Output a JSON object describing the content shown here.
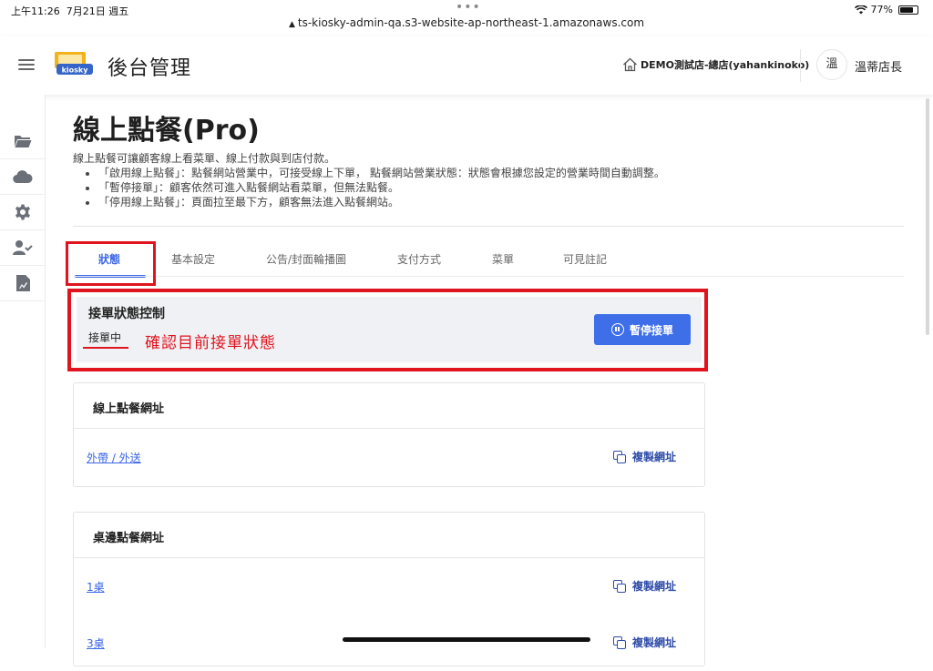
{
  "statusbar": {
    "time": "上午11:26",
    "date": "7月21日 週五",
    "battery": "77%",
    "battery_level": 0.77
  },
  "browser": {
    "url": "ts-kiosky-admin-qa.s3-website-ap-northeast-1.amazonaws.com"
  },
  "header": {
    "logo_text": "kiosky",
    "title": "後台管理",
    "store": "DEMO測試店-總店(yahankinoko)",
    "avatar": "溫",
    "user": "溫蒂店長"
  },
  "sidebar": {
    "items": [
      "folder-icon",
      "cloud-icon",
      "gear-icon",
      "user-check-icon",
      "report-icon"
    ]
  },
  "page": {
    "title": "線上點餐(Pro)",
    "intro": "線上點餐可讓顧客線上看菜單、線上付款與到店付款。",
    "bullets": [
      "「啟用線上點餐」：點餐網站營業中，可接受線上下單， 點餐網站營業狀態：狀態會根據您設定的營業時間自動調整。",
      "「暫停接單」：顧客依然可進入點餐網站看菜單，但無法點餐。",
      "「停用線上點餐」：頁面拉至最下方，顧客無法進入點餐網站。"
    ]
  },
  "tabs": [
    {
      "label": "狀態",
      "active": true
    },
    {
      "label": "基本設定"
    },
    {
      "label": "公告/封面輪播圖"
    },
    {
      "label": "支付方式"
    },
    {
      "label": "菜單"
    },
    {
      "label": "可見註記"
    }
  ],
  "status_card": {
    "title": "接單狀態控制",
    "value": "接單中",
    "annotation": "確認目前接單狀態",
    "pause_button": "暫停接單"
  },
  "online_urls": {
    "title": "線上點餐網址",
    "rows": [
      {
        "label": "外帶 / 外送",
        "copy": "複製網址"
      }
    ]
  },
  "table_urls": {
    "title": "桌邊點餐網址",
    "rows": [
      {
        "label": "1桌",
        "copy": "複製網址"
      },
      {
        "label": "3桌",
        "copy": "複製網址"
      }
    ]
  },
  "colors": {
    "accent": "#3e6ee8",
    "annotation_red": "#e0141e",
    "link": "#3a66e6"
  }
}
